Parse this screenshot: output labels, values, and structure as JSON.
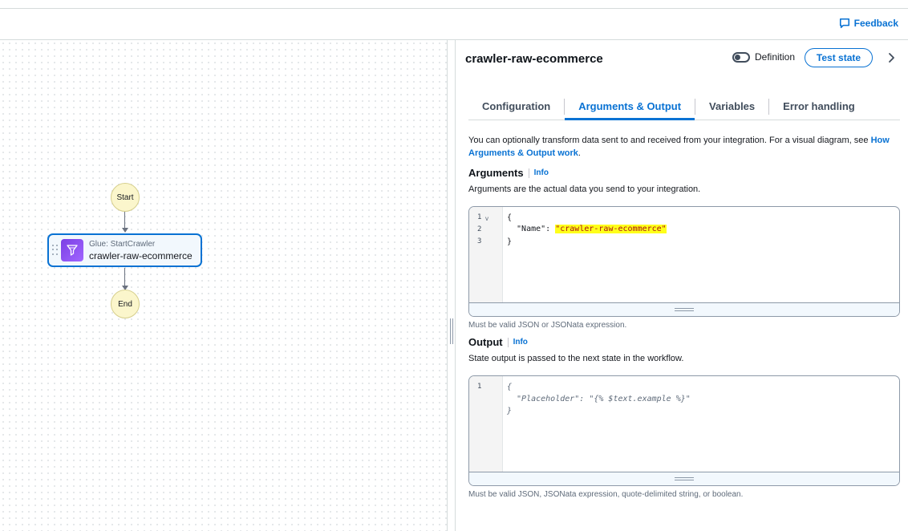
{
  "header": {
    "feedback_label": "Feedback"
  },
  "canvas": {
    "start_label": "Start",
    "end_label": "End",
    "task": {
      "type_label": "Glue: StartCrawler",
      "name": "crawler-raw-ecommerce"
    }
  },
  "panel": {
    "title": "crawler-raw-ecommerce",
    "definition_label": "Definition",
    "test_state_label": "Test state",
    "tabs": [
      {
        "label": "Configuration",
        "active": false
      },
      {
        "label": "Arguments & Output",
        "active": true
      },
      {
        "label": "Variables",
        "active": false
      },
      {
        "label": "Error handling",
        "active": false
      }
    ],
    "intro_text": "You can optionally transform data sent to and received from your integration. For a visual diagram, see ",
    "intro_link": "How Arguments & Output work",
    "intro_end": ".",
    "arguments": {
      "heading": "Arguments",
      "info": "Info",
      "description": "Arguments are the actual data you send to your integration.",
      "line_numbers": [
        "1",
        "2",
        "3"
      ],
      "code": {
        "open": "{",
        "key": "  \"Name\": ",
        "value": "\"crawler-raw-ecommerce\"",
        "close": "}"
      },
      "hint": "Must be valid JSON or JSONata expression."
    },
    "output": {
      "heading": "Output",
      "info": "Info",
      "description": "State output is passed to the next state in the workflow.",
      "line_numbers": [
        "1"
      ],
      "placeholder_lines": [
        "{",
        "  \"Placeholder\": \"{% $text.example %}\"",
        "}"
      ],
      "hint": "Must be valid JSON, JSONata expression, quote-delimited string, or boolean."
    }
  },
  "colors": {
    "accent": "#0972d3",
    "highlight": "#ffff1a",
    "node_fill": "#fbf6cc",
    "glue_icon": "#7b3fe4"
  },
  "icons": [
    "feedback-icon",
    "glue-icon",
    "chevron-right-icon",
    "drag-handle-icon",
    "toggle-icon"
  ]
}
